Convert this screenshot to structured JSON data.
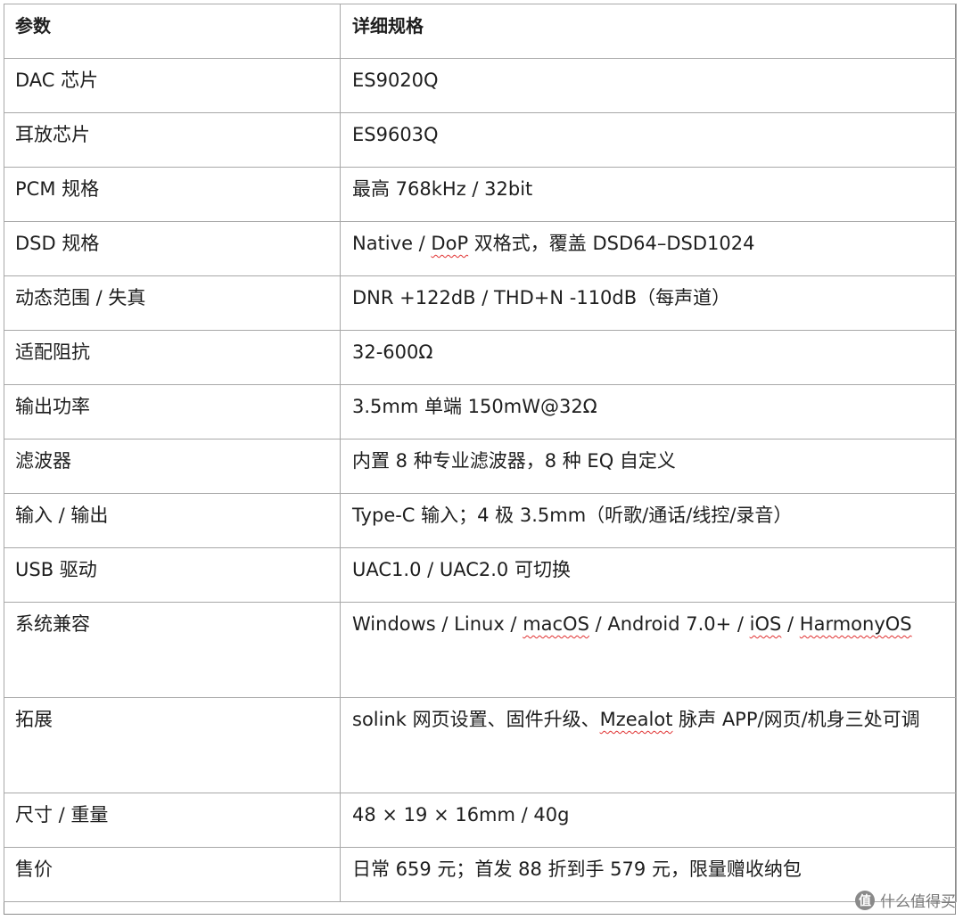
{
  "table": {
    "headers": [
      "参数",
      "详细规格"
    ],
    "rows": [
      {
        "param": "DAC 芯片",
        "spec": "ES9020Q"
      },
      {
        "param": "耳放芯片",
        "spec": "ES9603Q"
      },
      {
        "param": "PCM 规格",
        "spec": "最高 768kHz / 32bit"
      },
      {
        "param": "DSD 规格",
        "spec_a": "Native / ",
        "spec_w": "DoP",
        "spec_b": " 双格式，覆盖 DSD64–DSD1024"
      },
      {
        "param": "动态范围 / 失真",
        "spec": "DNR +122dB / THD+N -110dB（每声道）"
      },
      {
        "param": "适配阻抗",
        "spec": "32-600Ω"
      },
      {
        "param": "输出功率",
        "spec": "3.5mm 单端 150mW@32Ω"
      },
      {
        "param": "滤波器",
        "spec": "内置 8 种专业滤波器，8 种 EQ 自定义"
      },
      {
        "param": "输入 / 输出",
        "spec": "Type-C 输入；4 极 3.5mm（听歌/通话/线控/录音）"
      },
      {
        "param": "USB 驱动",
        "spec": "UAC1.0 / UAC2.0 可切换"
      },
      {
        "param": "系统兼容",
        "spec_a": "Windows / Linux / ",
        "spec_w1": "macOS",
        "spec_b": " / Android 7.0+ / ",
        "spec_w2": "iOS",
        "spec_c": " / ",
        "spec_w3": "HarmonyOS"
      },
      {
        "param": "拓展",
        "spec_a": "solink 网页设置、固件升级、",
        "spec_w": "Mzealot",
        "spec_b": " 脉声 APP/网页/机身三处可调"
      },
      {
        "param": "尺寸 / 重量",
        "spec": "48 × 19 × 16mm / 40g"
      },
      {
        "param": "售价",
        "spec": "日常 659 元；首发 88 折到手 579 元，限量赠收纳包"
      }
    ]
  },
  "watermark": {
    "logo": "值",
    "text": "什么值得买"
  }
}
